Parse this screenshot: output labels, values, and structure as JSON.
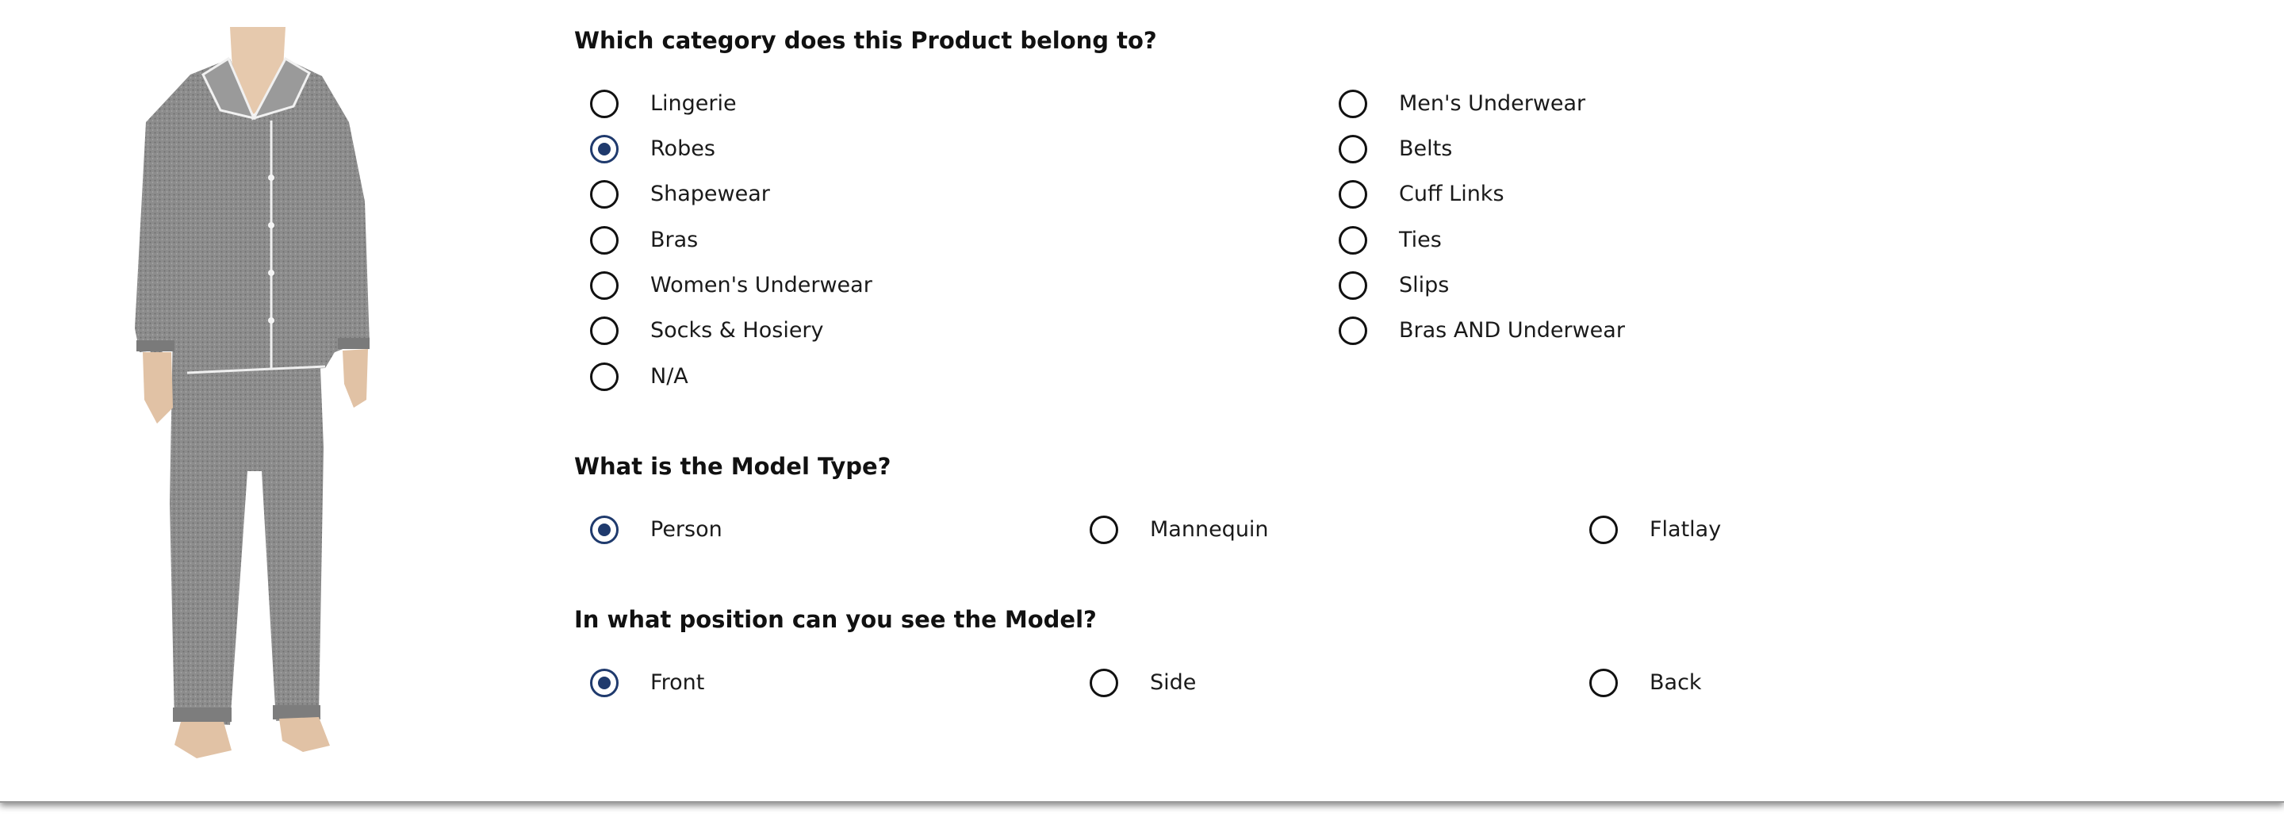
{
  "accent_color": "#1f3a6d",
  "product": {
    "image": "pajama-set-photo"
  },
  "category": {
    "title": "Which category does this Product belong to?",
    "selected": "Robes",
    "options": [
      "Lingerie",
      "Robes",
      "Shapewear",
      "Bras",
      "Women's Underwear",
      "Socks & Hosiery",
      "N/A",
      "Men's Underwear",
      "Belts",
      "Cuff Links",
      "Ties",
      "Slips",
      "Bras AND Underwear"
    ]
  },
  "model_type": {
    "title": "What is the Model Type?",
    "selected": "Person",
    "options": [
      "Person",
      "Mannequin",
      "Flatlay"
    ]
  },
  "model_position": {
    "title": "In what position can you see the Model?",
    "selected": "Front",
    "options": [
      "Front",
      "Side",
      "Back"
    ]
  }
}
